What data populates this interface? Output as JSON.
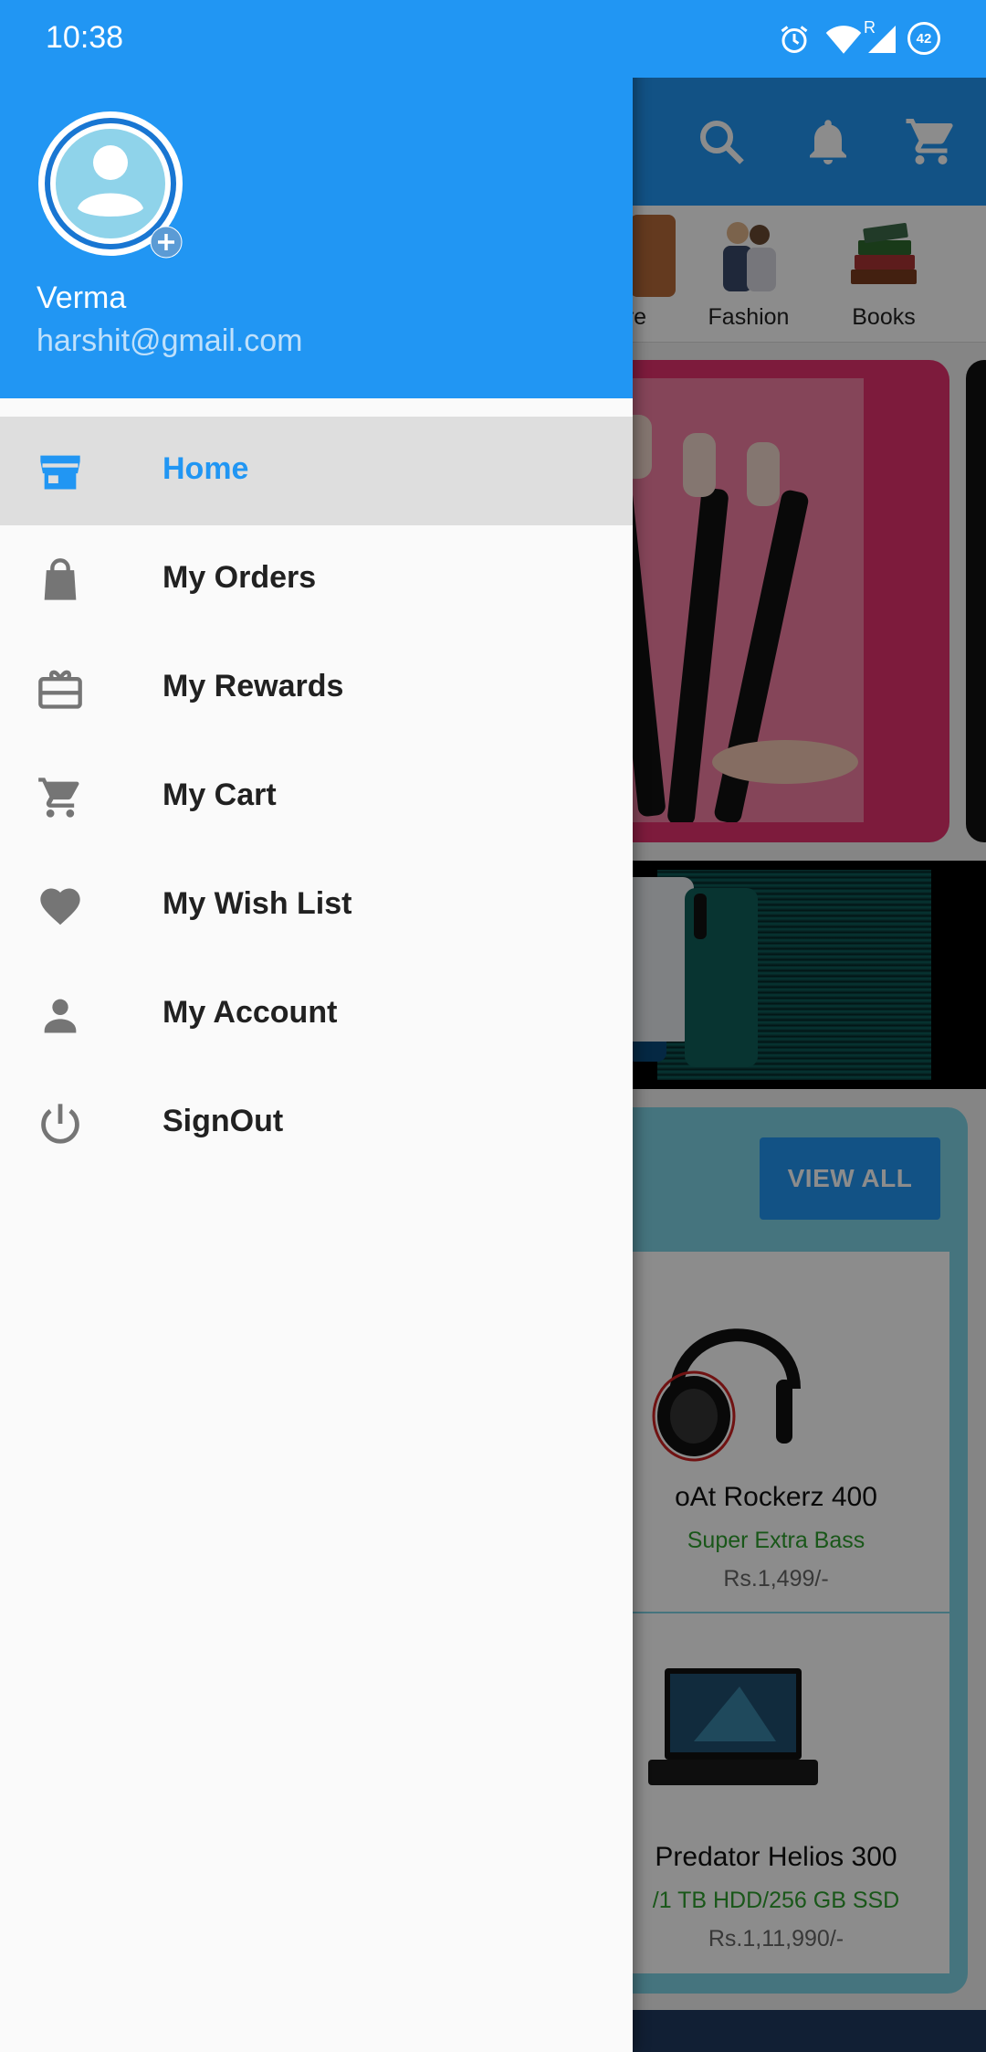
{
  "status_bar": {
    "time": "10:38",
    "icons": [
      "alarm-icon",
      "wifi-icon",
      "signal-icon",
      "battery-saver-icon"
    ],
    "battery_level": "42",
    "roaming_indicator": "R"
  },
  "drawer": {
    "user": {
      "name": "Verma",
      "email": "harshit@gmail.com",
      "avatar_icon": "account-circle-icon",
      "add_photo_icon": "add-icon"
    },
    "accent_color": "#2196f3",
    "items": [
      {
        "label": "Home",
        "icon": "store-icon",
        "active": true
      },
      {
        "label": "My Orders",
        "icon": "shopping-bag-icon",
        "active": false
      },
      {
        "label": "My Rewards",
        "icon": "gift-card-icon",
        "active": false
      },
      {
        "label": "My Cart",
        "icon": "cart-icon",
        "active": false
      },
      {
        "label": "My Wish List",
        "icon": "heart-icon",
        "active": false
      },
      {
        "label": "My Account",
        "icon": "person-icon",
        "active": false
      },
      {
        "label": "SignOut",
        "icon": "power-icon",
        "active": false
      }
    ]
  },
  "background_app": {
    "toolbar_icons": [
      "search-icon",
      "bell-icon",
      "cart-icon"
    ],
    "categories": [
      {
        "label": "ure"
      },
      {
        "label": "Fashion"
      },
      {
        "label": "Books"
      }
    ],
    "deals": {
      "view_all_label": "VIEW ALL",
      "products": [
        {
          "name": "oAt Rockerz 400",
          "description": "Super Extra Bass",
          "price": "Rs.1,499/-"
        },
        {
          "name": "Predator Helios 300",
          "description": "/1 TB HDD/256 GB SSD",
          "price": "Rs.1,11,990/-"
        }
      ]
    }
  }
}
